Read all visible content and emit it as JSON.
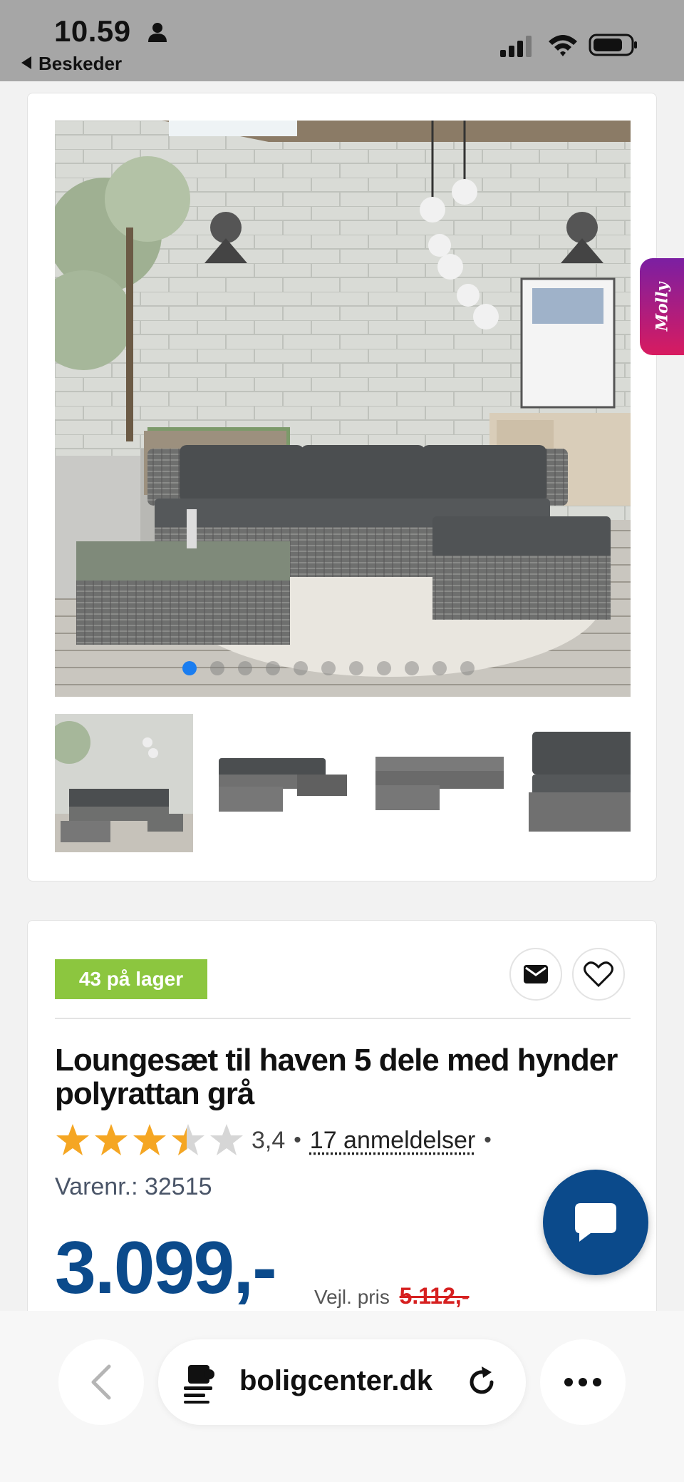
{
  "status_bar": {
    "time": "10.59",
    "back_app": "Beskeder"
  },
  "gallery": {
    "image_count": 11,
    "active_index": 0,
    "thumbnails": [
      "lifestyle-thumb",
      "set-thumb-1",
      "set-thumb-2",
      "corner-seat-thumb"
    ]
  },
  "side_tab": {
    "label": "Molly"
  },
  "product": {
    "stock_badge": "43 på lager",
    "title": "Loungesæt til haven 5 dele med hynder polyrattan grå",
    "rating": 3.4,
    "rating_label": "3,4",
    "reviews_label": "17 anmeldelser",
    "bullet": "•",
    "sku_label": "Varenr.: 32515",
    "price": "3.099,-",
    "rrp_label": "Vejl. pris",
    "rrp_value": "5.112,-"
  },
  "browser": {
    "url": "boligcenter.dk"
  },
  "colors": {
    "accent_blue": "#0b4a8b",
    "stock_green": "#8cc63f",
    "star_gold": "#f5a623",
    "rrp_red": "#d62020",
    "dot_active": "#1a7df0"
  },
  "icons": [
    "person-icon",
    "signal-icon",
    "wifi-icon",
    "battery-icon",
    "mail-icon",
    "heart-icon",
    "star-icon",
    "chat-icon",
    "chevron-left-icon",
    "site-icon",
    "reload-icon",
    "more-icon"
  ]
}
